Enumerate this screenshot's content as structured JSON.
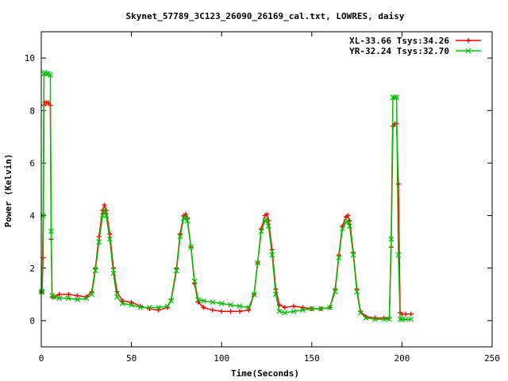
{
  "chart_data": {
    "type": "line",
    "title": "Skynet_57789_3C123_26090_26169_cal.txt, LOWRES, daisy",
    "xlabel": "Time(Seconds)",
    "ylabel": "Power (Kelvin)",
    "xlim": [
      0,
      250
    ],
    "ylim": [
      -1,
      11
    ],
    "xticks": [
      0,
      50,
      100,
      150,
      200,
      250
    ],
    "yticks": [
      0,
      2,
      4,
      6,
      8,
      10
    ],
    "grid": false,
    "legend_position": "top-right",
    "series": [
      {
        "name": "XL-33.66 Tsys:34.26",
        "color": "#ff0000",
        "marker": "plus",
        "x": [
          0,
          0.5,
          1,
          1.5,
          2,
          3,
          4,
          5,
          5.5,
          6,
          7,
          10,
          15,
          20,
          25,
          28,
          30,
          32,
          34,
          35,
          36,
          38,
          40,
          42,
          45,
          50,
          55,
          60,
          65,
          70,
          72,
          75,
          77,
          79,
          80,
          81,
          83,
          85,
          87,
          90,
          95,
          100,
          105,
          110,
          115,
          118,
          120,
          122,
          124,
          125,
          126,
          128,
          130,
          132,
          135,
          140,
          145,
          150,
          155,
          160,
          163,
          165,
          167,
          169,
          170,
          171,
          173,
          175,
          177,
          180,
          185,
          190,
          193,
          194,
          195,
          196,
          197,
          198,
          199,
          200,
          202,
          205
        ],
        "y": [
          1.1,
          1.1,
          2.4,
          8.2,
          8.3,
          8.3,
          8.3,
          8.2,
          3.1,
          0.9,
          0.9,
          1.0,
          1.0,
          0.95,
          0.9,
          1.1,
          2.0,
          3.2,
          4.2,
          4.4,
          4.2,
          3.3,
          2.0,
          1.1,
          0.75,
          0.7,
          0.55,
          0.45,
          0.4,
          0.5,
          0.8,
          2.0,
          3.3,
          4.0,
          4.05,
          3.9,
          2.8,
          1.4,
          0.7,
          0.5,
          0.4,
          0.35,
          0.35,
          0.35,
          0.4,
          1.0,
          2.2,
          3.5,
          4.0,
          4.05,
          3.8,
          2.7,
          1.2,
          0.6,
          0.5,
          0.55,
          0.5,
          0.45,
          0.45,
          0.5,
          1.2,
          2.5,
          3.6,
          3.95,
          4.0,
          3.8,
          2.6,
          1.2,
          0.35,
          0.15,
          0.1,
          0.1,
          0.1,
          2.8,
          7.4,
          7.5,
          7.5,
          5.2,
          0.3,
          0.25,
          0.25,
          0.25
        ]
      },
      {
        "name": "YR-32.24 Tsys:32.70",
        "color": "#00c000",
        "marker": "x",
        "x": [
          0,
          0.5,
          1,
          1.5,
          2,
          3,
          4,
          5,
          5.5,
          6,
          7,
          10,
          15,
          20,
          25,
          28,
          30,
          32,
          34,
          35,
          36,
          38,
          40,
          42,
          45,
          50,
          55,
          60,
          65,
          70,
          72,
          75,
          77,
          79,
          80,
          81,
          83,
          85,
          87,
          90,
          95,
          100,
          105,
          110,
          115,
          118,
          120,
          122,
          124,
          125,
          126,
          128,
          130,
          132,
          135,
          140,
          145,
          150,
          155,
          160,
          163,
          165,
          167,
          169,
          170,
          171,
          173,
          175,
          177,
          180,
          185,
          190,
          193,
          194,
          195,
          196,
          197,
          198,
          199,
          200,
          202,
          205
        ],
        "y": [
          1.1,
          1.1,
          4.0,
          9.4,
          9.45,
          9.4,
          9.4,
          9.35,
          3.4,
          0.95,
          0.9,
          0.85,
          0.85,
          0.8,
          0.85,
          1.0,
          1.9,
          3.0,
          4.0,
          4.2,
          4.0,
          3.1,
          1.8,
          0.9,
          0.65,
          0.6,
          0.5,
          0.5,
          0.5,
          0.55,
          0.75,
          1.9,
          3.2,
          3.9,
          3.95,
          3.8,
          2.8,
          1.5,
          0.8,
          0.75,
          0.7,
          0.65,
          0.6,
          0.55,
          0.5,
          1.0,
          2.2,
          3.4,
          3.8,
          3.85,
          3.6,
          2.5,
          1.0,
          0.35,
          0.3,
          0.35,
          0.4,
          0.45,
          0.45,
          0.5,
          1.1,
          2.4,
          3.5,
          3.75,
          3.8,
          3.6,
          2.5,
          1.1,
          0.3,
          0.1,
          0.05,
          0.05,
          0.05,
          3.1,
          8.5,
          8.5,
          8.5,
          2.5,
          0.05,
          0.05,
          0.05,
          0.05
        ]
      }
    ]
  }
}
